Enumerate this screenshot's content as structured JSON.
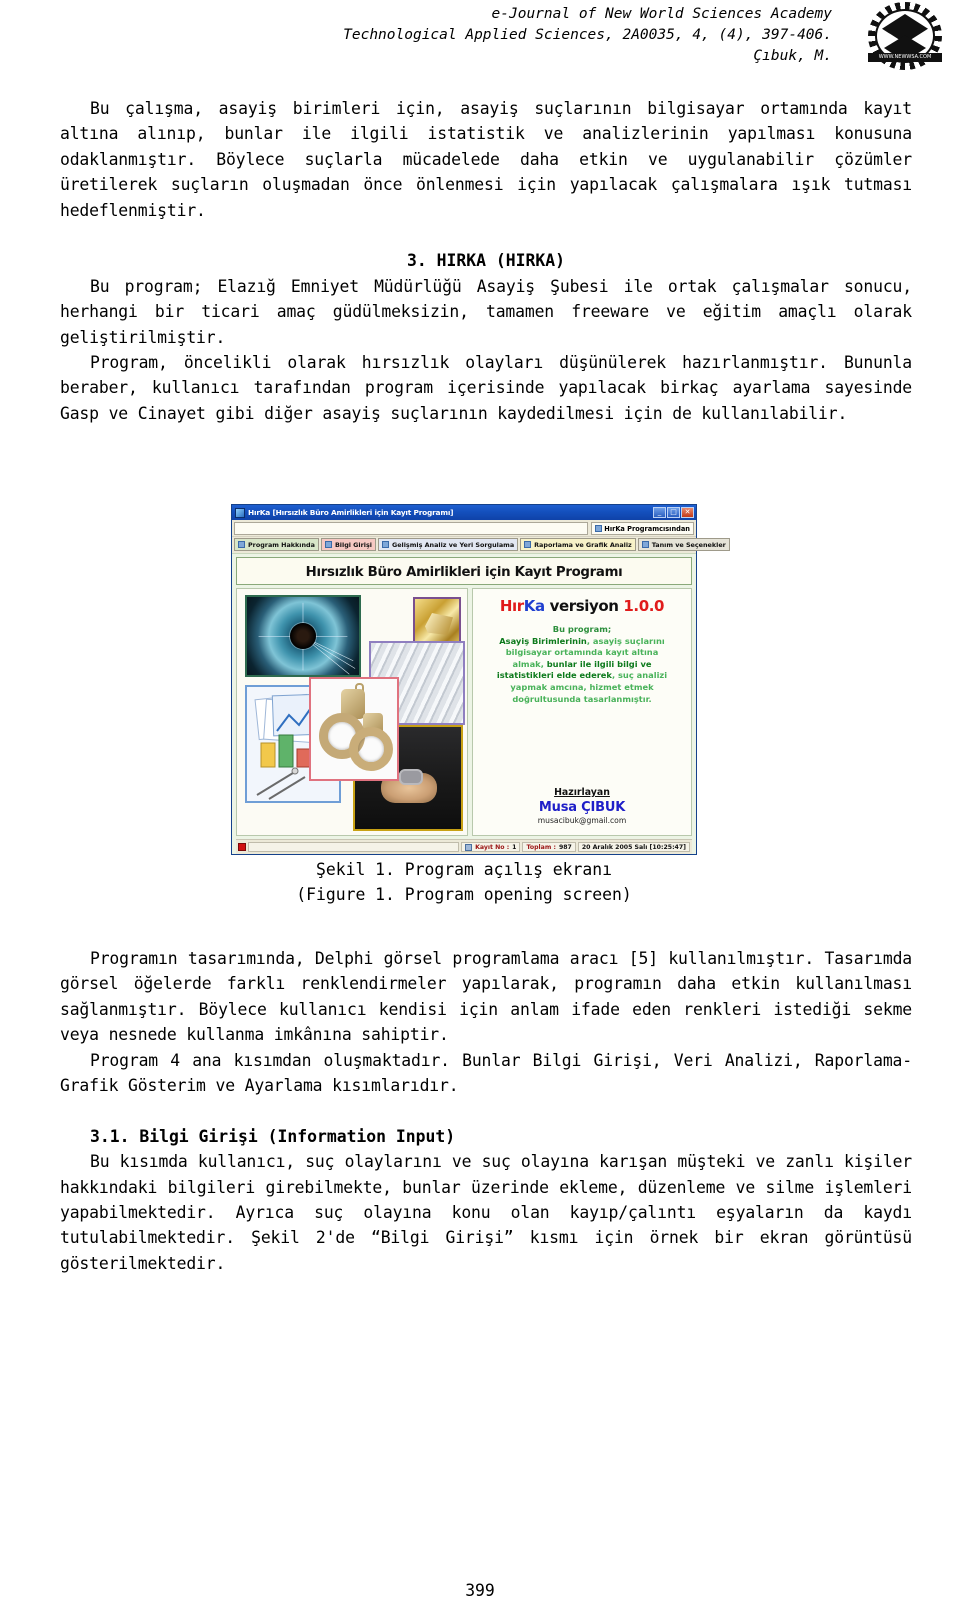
{
  "running_head": {
    "line1": "e-Journal of New World Sciences Academy",
    "line2": "Technological Applied Sciences, 2A0035, 4, (4), 397-406.",
    "line3": "Çıbuk, M.",
    "logo_text": "WWW.NEWWSA.COM"
  },
  "body": {
    "para1": "Bu çalışma, asayiş birimleri için, asayiş suçlarının bilgisayar ortamında kayıt altına alınıp, bunlar ile ilgili istatistik ve analizlerinin yapılması konusuna odaklanmıştır. Böylece suçlarla mücadelede daha etkin ve uygulanabilir çözümler üretilerek suçların oluşmadan önce önlenmesi için yapılacak çalışmalara ışık tutması hedeflenmiştir.",
    "heading3": "3. HIRKA (HIRKA)",
    "para2": "Bu program; Elazığ Emniyet Müdürlüğü Asayiş Şubesi ile ortak çalışmalar sonucu, herhangi bir ticari amaç güdülmeksizin, tamamen freeware ve eğitim amaçlı olarak geliştirilmiştir.",
    "para3": "Program, öncelikli olarak hırsızlık olayları düşünülerek hazırlanmıştır. Bununla beraber, kullanıcı tarafından program içerisinde yapılacak birkaç ayarlama sayesinde Gasp ve Cinayet gibi diğer asayiş suçlarının kaydedilmesi için de kullanılabilir.",
    "para4": "Programın tasarımında, Delphi görsel programlama aracı [5] kullanılmıştır. Tasarımda görsel öğelerde farklı renklendirmeler yapılarak, programın daha etkin kullanılması sağlanmıştır. Böylece kullanıcı kendisi için anlam ifade eden renkleri istediği sekme veya nesnede kullanma imkânına sahiptir.",
    "para5": "Program 4 ana kısımdan oluşmaktadır. Bunlar Bilgi Girişi, Veri Analizi, Raporlama-Grafik Gösterim ve Ayarlama kısımlarıdır.",
    "heading31": "3.1. Bilgi Girişi (Information Input)",
    "para6": "Bu kısımda kullanıcı, suç olaylarını ve suç olayına karışan müşteki ve zanlı kişiler hakkındaki bilgileri girebilmekte, bunlar üzerinde ekleme, düzenleme ve silme işlemleri yapabilmektedir. Ayrıca suç olayına konu olan kayıp/çalıntı eşyaların da kaydı tutulabilmektedir. Şekil 2'de “Bilgi Girişi” kısmı için örnek bir ekran görüntüsü gösterilmektedir."
  },
  "figure": {
    "caption_tr": "Şekil 1. Program açılış ekranı",
    "caption_en": "(Figure 1. Program opening screen)"
  },
  "app": {
    "title": "HırKa [Hırsızlık Büro Amirlikleri için Kayıt Programı]",
    "window_buttons": {
      "minimize": "_",
      "maximize": "□",
      "close": "✕"
    },
    "menu": {
      "about_programmer": "HırKa Programcısından"
    },
    "tabs": [
      {
        "label": "Program Hakkında"
      },
      {
        "label": "Bilgi Girişi"
      },
      {
        "label": "Gelişmiş Analiz ve Yeri Sorgulama"
      },
      {
        "label": "Raporlama ve Grafik Analiz"
      },
      {
        "label": "Tanım ve Seçenekler"
      }
    ],
    "banner": "Hırsızlık Büro Amirlikleri için Kayıt Programı",
    "version": {
      "hir": "Hır",
      "ka": "Ka",
      "word": " versiyon ",
      "number": "1.0.0"
    },
    "description": {
      "l1": "Bu program;",
      "l2a": "Asayiş Birimlerinin",
      "l2b": ", asayiş suçlarını",
      "l3": "bilgisayar ortamında kayıt altına",
      "l4a": "almak, ",
      "l4b": "bunlar ile ilgili bilgi ve",
      "l5a": "istatistikleri elde ederek",
      "l5b": ", suç analizi",
      "l6": "yapmak amcına, hizmet etmek",
      "l7": "doğrultusunda tasarlanmıştır."
    },
    "author": {
      "label": "Hazırlayan",
      "name": "Musa ÇIBUK",
      "email": "musacibuk@gmail.com"
    },
    "statusbar": {
      "record_label": "Kayıt No :",
      "record_value": "1",
      "total_label": "Toplam :",
      "total_value": "987",
      "datetime": "20 Aralık 2005 Salı [10:25:47]"
    },
    "colors": {
      "titlebar": "#1450bd",
      "accent_red": "#e01b1b",
      "accent_blue": "#1f3fd0",
      "desc_green": "#2c8f3c"
    }
  },
  "page_number": "399"
}
